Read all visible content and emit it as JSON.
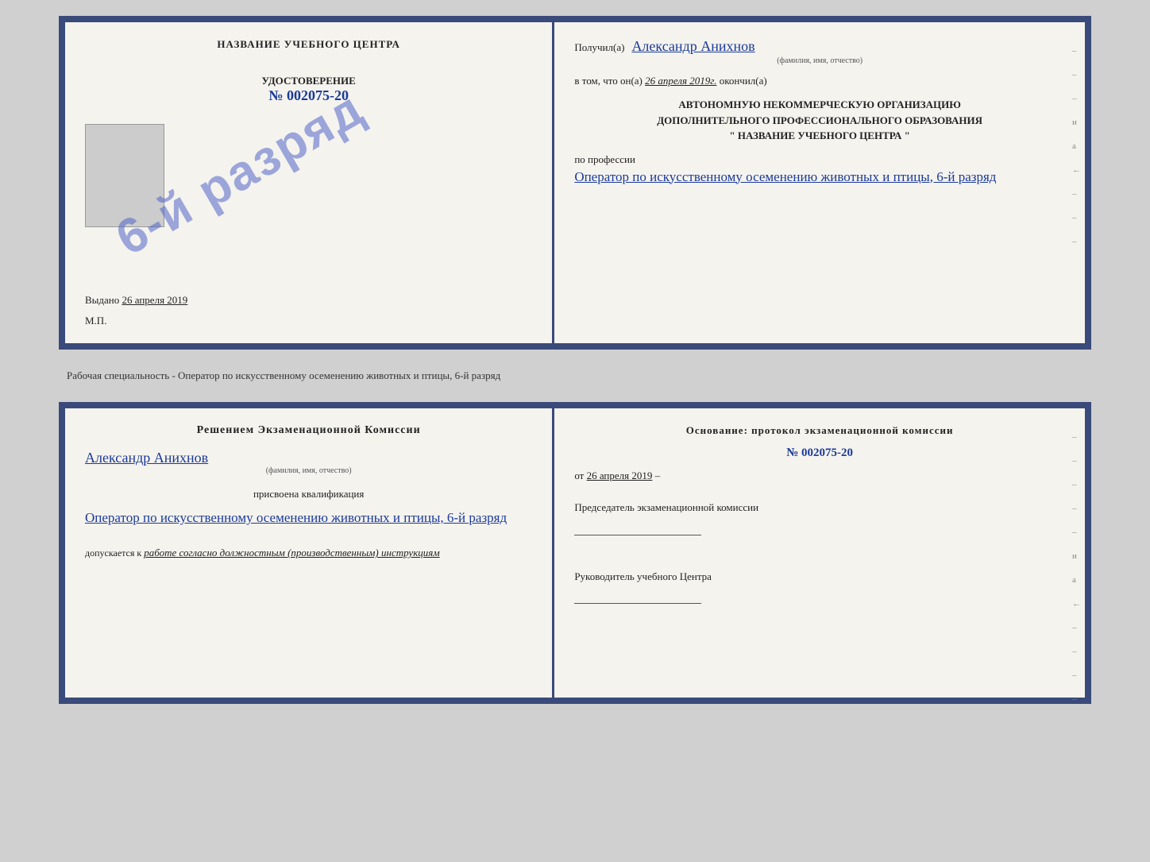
{
  "top_left": {
    "center_title": "НАЗВАНИЕ УЧЕБНОГО ЦЕНТРА",
    "cert_label": "УДОСТОВЕРЕНИЕ",
    "cert_number": "№ 002075-20",
    "issued_label": "Выдано",
    "issued_date": "26 апреля 2019",
    "mp_label": "М.П."
  },
  "stamp": {
    "text": "6-й разряд"
  },
  "top_right": {
    "received_label": "Получил(а)",
    "received_name": "Александр Анихнов",
    "received_subtitle": "(фамилия, имя, отчество)",
    "date_prefix": "в том, что он(а)",
    "date_value": "26 апреля 2019г.",
    "date_suffix": "окончил(а)",
    "org_line1": "АВТОНОМНУЮ НЕКОММЕРЧЕСКУЮ ОРГАНИЗАЦИЮ",
    "org_line2": "ДОПОЛНИТЕЛЬНОГО ПРОФЕССИОНАЛЬНОГО ОБРАЗОВАНИЯ",
    "org_line3": "\" НАЗВАНИЕ УЧЕБНОГО ЦЕНТРА \"",
    "profession_label": "по профессии",
    "profession_value": "Оператор по искусственному осеменению животных и птицы, 6-й разряд",
    "side_marks": [
      "-",
      "-",
      "-",
      "и",
      "а",
      "←",
      "-",
      "-",
      "-",
      "-"
    ]
  },
  "subtitle": {
    "text": "Рабочая специальность - Оператор по искусственному осеменению животных и птицы, 6-й разряд"
  },
  "bottom_left": {
    "decision_title": "Решением экзаменационной комиссии",
    "person_name": "Александр Анихнов",
    "person_subtitle": "(фамилия, имя, отчество)",
    "qualification_label": "присвоена квалификация",
    "qualification_value": "Оператор по искусственному осеменению животных и птицы, 6-й разряд",
    "admitted_prefix": "допускается к",
    "admitted_value": "работе согласно должностным (производственным) инструкциям"
  },
  "bottom_right": {
    "basis_title": "Основание: протокол экзаменационной комиссии",
    "protocol_number": "№ 002075-20",
    "protocol_date_prefix": "от",
    "protocol_date": "26 апреля 2019",
    "chairman_label": "Председатель экзаменационной комиссии",
    "director_label": "Руководитель учебного Центра",
    "side_marks": [
      "-",
      "-",
      "-",
      "-",
      "-",
      "и",
      "а",
      "←",
      "-",
      "-",
      "-",
      "-",
      "-"
    ]
  }
}
